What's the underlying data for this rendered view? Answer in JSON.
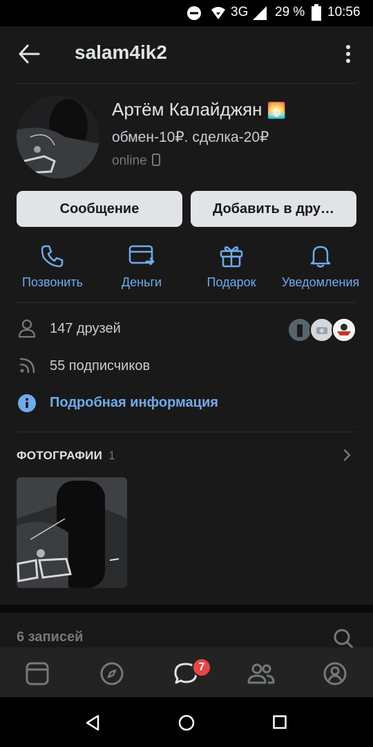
{
  "status_bar": {
    "network": "3G",
    "battery": "29 %",
    "time": "10:56"
  },
  "header": {
    "username": "salam4ik2",
    "back_icon": "arrow-left-icon",
    "menu_icon": "more-vertical-icon"
  },
  "profile": {
    "name": "Артём Калайджян",
    "name_emoji": "🌅",
    "status": "обмен-10₽. сделка-20₽",
    "online": "online"
  },
  "buttons": {
    "message": "Сообщение",
    "add_friend": "Добавить в дру…"
  },
  "actions": [
    {
      "label": "Позвонить",
      "icon": "phone-icon"
    },
    {
      "label": "Деньги",
      "icon": "money-transfer-icon"
    },
    {
      "label": "Подарок",
      "icon": "gift-icon"
    },
    {
      "label": "Уведомления",
      "icon": "bell-icon"
    }
  ],
  "info": {
    "friends": "147 друзей",
    "subscribers": "55 подписчиков",
    "details": "Подробная информация"
  },
  "photos": {
    "title": "ФОТОГРАФИИ",
    "count": "1"
  },
  "wall": {
    "records": "6 записей"
  },
  "tabbar": {
    "messages_badge": "7"
  },
  "colors": {
    "accent": "#71aaeb",
    "background": "#19191a",
    "badge": "#e64646"
  }
}
